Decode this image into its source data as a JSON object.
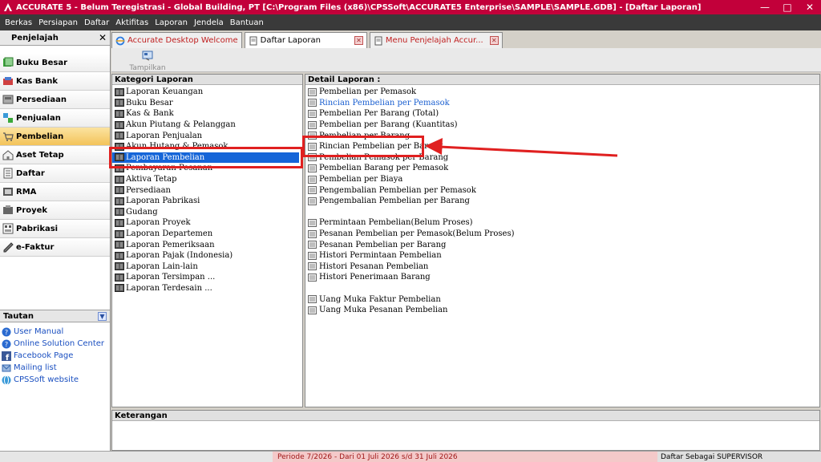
{
  "titlebar": {
    "title": "ACCURATE 5  - Belum Teregistrasi - Global Building, PT   [C:\\Program Files (x86)\\CPSSoft\\ACCURATE5 Enterprise\\SAMPLE\\SAMPLE.GDB] - [Daftar Laporan]",
    "minimize": "—",
    "maximize": "□",
    "close": "✕"
  },
  "menu": [
    "Berkas",
    "Persiapan",
    "Daftar",
    "Aktifitas",
    "Laporan",
    "Jendela",
    "Bantuan"
  ],
  "navigator": {
    "title": "Penjelajah",
    "close": "✕",
    "items": [
      {
        "label": "Buku Besar",
        "icon": "ledger-icon"
      },
      {
        "label": "Kas Bank",
        "icon": "cash-bank-icon"
      },
      {
        "label": "Persediaan",
        "icon": "inventory-icon"
      },
      {
        "label": "Penjualan",
        "icon": "sales-icon"
      },
      {
        "label": "Pembelian",
        "icon": "cart-icon"
      },
      {
        "label": "Aset Tetap",
        "icon": "house-icon"
      },
      {
        "label": "Daftar",
        "icon": "list-icon"
      },
      {
        "label": "RMA",
        "icon": "rma-icon"
      },
      {
        "label": "Proyek",
        "icon": "project-icon"
      },
      {
        "label": "Pabrikasi",
        "icon": "factory-icon"
      },
      {
        "label": "e-Faktur",
        "icon": "efaktur-icon"
      }
    ],
    "active_index": 4
  },
  "tautan": {
    "title": "Tautan",
    "links": [
      "User Manual",
      "Online Solution Center",
      "Facebook Page",
      "Mailing list",
      "CPSSoft website"
    ]
  },
  "tabs": [
    {
      "label": "Accurate Desktop Welcome"
    },
    {
      "label": "Daftar Laporan"
    },
    {
      "label": "Menu Penjelajah Accur..."
    }
  ],
  "toolbar": {
    "tampilkan": "Tampilkan"
  },
  "kategori": {
    "header": "Kategori Laporan",
    "items": [
      "Laporan Keuangan",
      "Buku Besar",
      "Kas & Bank",
      "Akun Piutang & Pelanggan",
      "Laporan Penjualan",
      "Akun Hutang & Pemasok",
      "Laporan Pembelian",
      "Pembayaran Pesanan",
      "Aktiva Tetap",
      "Persediaan",
      "Laporan Pabrikasi",
      "Gudang",
      "Laporan Proyek",
      "Laporan Departemen",
      "Laporan Pemeriksaan",
      "Laporan Pajak (Indonesia)",
      "Laporan Lain-lain",
      "Laporan Tersimpan ...",
      "Laporan Terdesain ..."
    ],
    "selected_index": 6
  },
  "detail": {
    "header": "Detail Laporan :",
    "group1": [
      "Pembelian per Pemasok",
      "Rincian Pembelian per Pemasok",
      "Pembelian Per Barang (Total)",
      "Pembelian per Barang (Kuantitas)",
      "Pembelian per Barang",
      "Rincian Pembelian per Barang",
      "Pembelian Pemasok per Barang",
      "Pembelian Barang per Pemasok",
      "Pembelian per Biaya",
      "Pengembalian Pembelian per Pemasok",
      "Pengembalian Pembelian per Barang"
    ],
    "group2": [
      "Permintaan Pembelian(Belum Proses)",
      "Pesanan Pembelian per Pemasok(Belum Proses)",
      "Pesanan Pembelian per Barang",
      "Histori Permintaan Pembelian",
      "Histori Pesanan Pembelian",
      "Histori Penerimaan Barang"
    ],
    "group3": [
      "Uang Muka Faktur Pembelian",
      "Uang Muka Pesanan Pembelian"
    ]
  },
  "keterangan": {
    "header": "Keterangan"
  },
  "status": {
    "periode": "Periode 7/2026 - Dari 01 Juli 2026 s/d 31 Juli 2026",
    "user": "Daftar Sebagai SUPERVISOR"
  },
  "colors": {
    "title_bar": "#c2003a",
    "selection": "#1565d8",
    "annotation": "#e02020",
    "link": "#1a4fc0"
  }
}
